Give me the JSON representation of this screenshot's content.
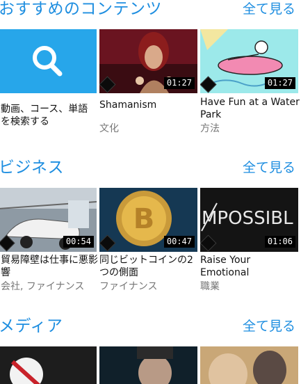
{
  "see_all_label": "全て見る",
  "accent_color": "#1e8ee0",
  "sections": [
    {
      "title": "おすすめのコンテンツ",
      "cards": [
        {
          "kind": "search",
          "title": "動画、コース、単語を検索する",
          "subtitle": ""
        },
        {
          "title": "Shamanism",
          "subtitle": "文化",
          "duration": "01:27"
        },
        {
          "title": "Have Fun at a Water Park",
          "subtitle": "方法",
          "duration": "01:27"
        }
      ]
    },
    {
      "title": "ビジネス",
      "cards": [
        {
          "title": "貿易障壁は仕事に悪影響",
          "subtitle": "会社, ファイナンス",
          "duration": "00:54"
        },
        {
          "title": "同じビットコインの2つの側面",
          "subtitle": "ファイナンス",
          "duration": "00:47"
        },
        {
          "title": "Raise Your Emotional",
          "subtitle": "職業",
          "duration": "01:06"
        }
      ]
    },
    {
      "title": "メディア",
      "cards": []
    }
  ]
}
